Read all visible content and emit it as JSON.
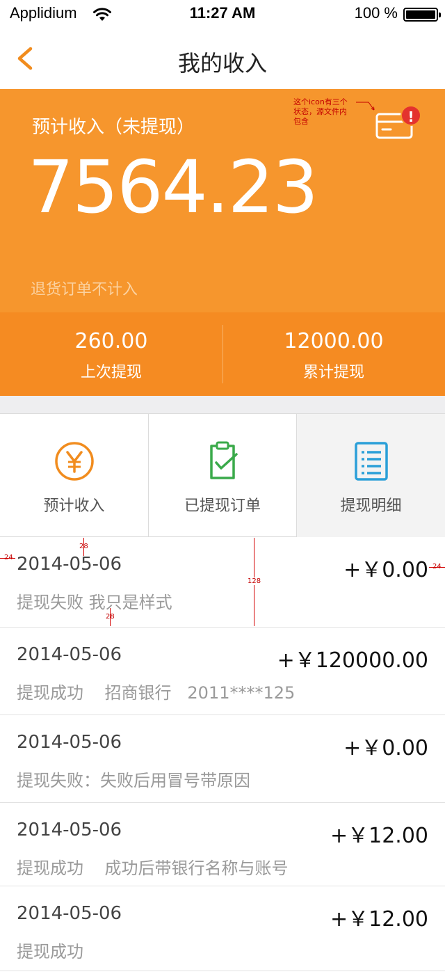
{
  "status_bar": {
    "carrier": "Applidium",
    "time": "11:27 AM",
    "battery_text": "100 %",
    "battery_level": 1.0
  },
  "nav": {
    "title": "我的收入",
    "back_icon": "chevron-left-icon"
  },
  "income": {
    "label": "预计收入（未提现）",
    "amount": "7564.23",
    "note": "退货订单不计入",
    "card_icon": "credit-card-icon",
    "badge": "!",
    "annotation": "这个icon有三个\n状态，源文件内\n包含"
  },
  "summary": [
    {
      "value": "260.00",
      "label": "上次提现"
    },
    {
      "value": "12000.00",
      "label": "累计提现"
    }
  ],
  "tabs": [
    {
      "label": "预计收入",
      "icon": "yen-circle-icon",
      "color": "#f18c1e",
      "selected": false
    },
    {
      "label": "已提现订单",
      "icon": "clipboard-check-icon",
      "color": "#3aaa4a",
      "selected": false
    },
    {
      "label": "提现明细",
      "icon": "list-document-icon",
      "color": "#2a9fd8",
      "selected": true
    }
  ],
  "records": [
    {
      "date": "2014-05-06",
      "amount": "+￥0.00",
      "desc": "提现失败 我只是样式"
    },
    {
      "date": "2014-05-06",
      "amount": "+￥120000.00",
      "desc": "提现成功    招商银行   2011****125"
    },
    {
      "date": "2014-05-06",
      "amount": "+￥0.00",
      "desc": "提现失败：失败后用冒号带原因"
    },
    {
      "date": "2014-05-06",
      "amount": "+￥12.00",
      "desc": "提现成功    成功后带银行名称与账号"
    },
    {
      "date": "2014-05-06",
      "amount": "+￥12.00",
      "desc": "提现成功"
    }
  ],
  "spec_marks": {
    "left_margin": "24",
    "right_margin": "24",
    "top_padding": "28",
    "bottom_padding": "28",
    "row_height": "128"
  },
  "colors": {
    "accent": "#f6962d",
    "summary_bg": "#f58b22",
    "alert": "#e4322e"
  }
}
